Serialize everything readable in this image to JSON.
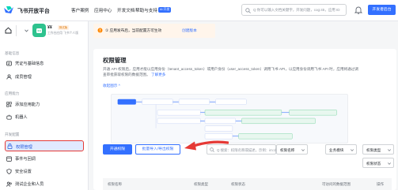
{
  "topnav": {
    "brand": "飞书开放平台",
    "links": [
      "客户案例",
      "应用中心",
      "开发文档",
      "帮助与支持"
    ],
    "badge": "AI 开发",
    "search_placeholder": "Q 你可以输入文档关键字，开发问题，cog:45，应用 ID",
    "cta": "开发者后台"
  },
  "app": {
    "name": "¥¥",
    "tag": "测试版",
    "subtitle": "工作台应用 飞书个人版"
  },
  "sidebar": {
    "sections": [
      {
        "title": "基础信息",
        "items": [
          "凭证与基础信息",
          "成员管理"
        ]
      },
      {
        "title": "应用能力",
        "items": [
          "添加应用能力",
          "机器人"
        ]
      },
      {
        "title": "开发配置",
        "items": [
          "权限管理",
          "事件与回调",
          "安全设置",
          "测试企业和人员"
        ]
      }
    ]
  },
  "banner": {
    "text": "① 应用发布后，当前配置方可生效",
    "link": "创建版本"
  },
  "main": {
    "title": "权限管理",
    "desc_1": "开通 API 权限后，应用才能以应用身份（tenant_access_token）或用户身份（user_access_token）调用飞书 API，以应用身份调用飞书 API 时，应用将通过调查审批获取权限的数据范围。",
    "desc_link": "了解更多",
    "collapse": "收起图示 ^",
    "btn_primary": "开通权限",
    "btn_batch": "批量导入/导出权限",
    "filter_search": "Q 搜索：权限名称或描述，示例：im:chat...",
    "selects": [
      "权限名称",
      "业务模块",
      "权限类型",
      "权限状态"
    ],
    "columns": [
      "权限名称",
      "权限类型",
      "权限状态",
      "可访问的数据范围",
      "操作"
    ]
  },
  "colors": {
    "primary": "#3370ff",
    "highlight": "#e53935",
    "app_icon": "#2ec28e"
  }
}
